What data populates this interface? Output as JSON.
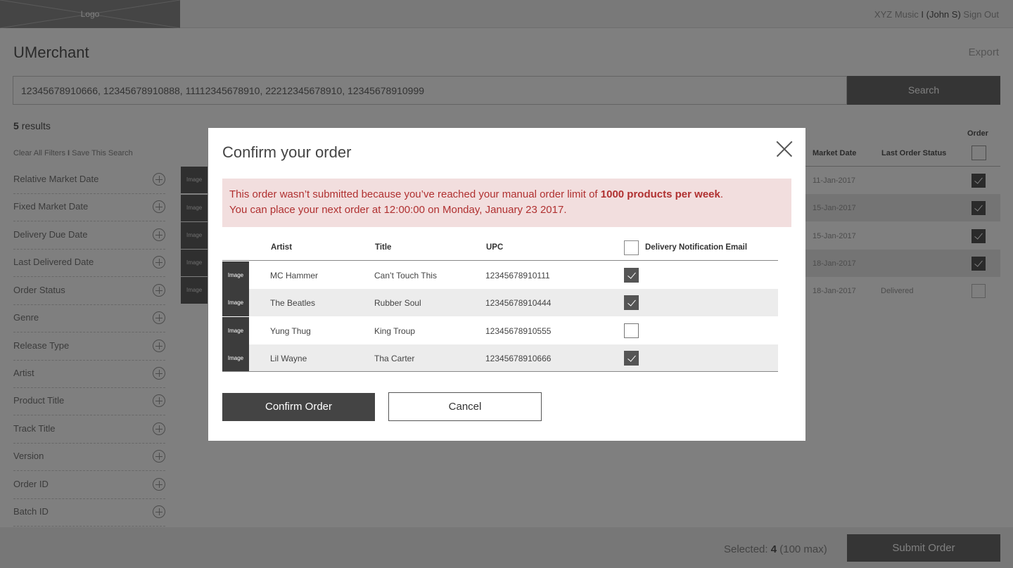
{
  "header": {
    "logo": "Logo",
    "account": "XYZ Music",
    "separator": "I",
    "user": "(John S)",
    "sign_out": "Sign Out"
  },
  "app_title": "UMerchant",
  "export_label": "Export",
  "search": {
    "value": "12345678910666, 12345678910888, 11112345678910, 22212345678910, 12345678910999",
    "button": "Search"
  },
  "results": {
    "count": "5",
    "label": "results"
  },
  "filter_links": {
    "clear": "Clear All Filters",
    "separator": "I",
    "save": "Save This Search"
  },
  "facets": [
    "Relative Market Date",
    "Fixed Market Date",
    "Delivery Due Date",
    "Last Delivered Date",
    "Order Status",
    "Genre",
    "Release Type",
    "Artist",
    "Product Title",
    "Track Title",
    "Version",
    "Order ID",
    "Batch ID"
  ],
  "bg_table": {
    "thumb_label": "Image",
    "headers": {
      "market_date": "Market Date",
      "last_status": "Last Order Status",
      "order": "Order"
    },
    "rows": [
      {
        "date": "11-Jan-2017",
        "status": "",
        "checked": true
      },
      {
        "date": "15-Jan-2017",
        "status": "",
        "checked": true
      },
      {
        "date": "15-Jan-2017",
        "status": "",
        "checked": true
      },
      {
        "date": "18-Jan-2017",
        "status": "",
        "checked": true
      },
      {
        "date": "18-Jan-2017",
        "status": "Delivered",
        "checked": false
      }
    ]
  },
  "footer": {
    "selected_label": "Selected:",
    "selected_count": "4",
    "selected_max": "(100 max)",
    "submit": "Submit Order"
  },
  "modal": {
    "title": "Confirm your order",
    "alert": {
      "line1_pre": "This order wasn’t submitted because you’ve reached your manual order limit of ",
      "line1_bold": "1000 products per week",
      "line1_post": ".",
      "line2": "You can place your next order at 12:00:00 on Monday, January 23 2017."
    },
    "columns": {
      "artist": "Artist",
      "title": "Title",
      "upc": "UPC",
      "email": "Delivery Notification Email"
    },
    "thumb_label": "Image",
    "rows": [
      {
        "artist": "MC Hammer",
        "title": "Can’t Touch This",
        "upc": "12345678910111",
        "email": true
      },
      {
        "artist": "The Beatles",
        "title": "Rubber Soul",
        "upc": "12345678910444",
        "email": true
      },
      {
        "artist": "Yung Thug",
        "title": "King Troup",
        "upc": "12345678910555",
        "email": false
      },
      {
        "artist": "Lil Wayne",
        "title": "Tha Carter",
        "upc": "12345678910666",
        "email": true
      }
    ],
    "confirm_button": "Confirm Order",
    "cancel_button": "Cancel"
  }
}
